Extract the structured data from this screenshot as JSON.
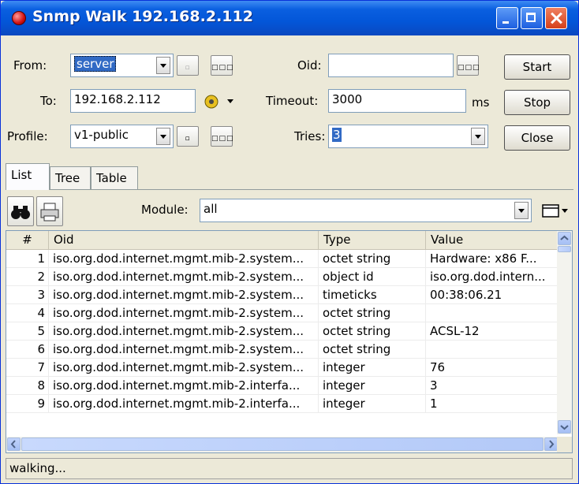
{
  "window": {
    "title": "Snmp Walk 192.168.2.112"
  },
  "form": {
    "from_label": "From:",
    "from_value": "server",
    "to_label": "To:",
    "to_value": "192.168.2.112",
    "profile_label": "Profile:",
    "profile_value": "v1-public",
    "oid_label": "Oid:",
    "oid_value": "",
    "timeout_label": "Timeout:",
    "timeout_value": "3000",
    "timeout_unit": "ms",
    "tries_label": "Tries:",
    "tries_value": "3",
    "small_btn_glyph": "▫",
    "dots_glyph": "□□□"
  },
  "buttons": {
    "start": "Start",
    "stop": "Stop",
    "close": "Close"
  },
  "tabs": [
    {
      "label": "List",
      "active": true
    },
    {
      "label": "Tree",
      "active": false
    },
    {
      "label": "Table",
      "active": false
    }
  ],
  "toolbar": {
    "module_label": "Module:",
    "module_value": "all",
    "icons": [
      "binoculars-icon",
      "printer-icon",
      "columns-icon"
    ]
  },
  "table": {
    "columns": [
      "#",
      "Oid",
      "Type",
      "Value"
    ],
    "rows": [
      {
        "n": "1",
        "oid": "iso.org.dod.internet.mgmt.mib-2.system...",
        "type": "octet string",
        "value": "Hardware: x86 F..."
      },
      {
        "n": "2",
        "oid": "iso.org.dod.internet.mgmt.mib-2.system...",
        "type": "object id",
        "value": "iso.org.dod.intern..."
      },
      {
        "n": "3",
        "oid": "iso.org.dod.internet.mgmt.mib-2.system...",
        "type": "timeticks",
        "value": "00:38:06.21"
      },
      {
        "n": "4",
        "oid": "iso.org.dod.internet.mgmt.mib-2.system...",
        "type": "octet string",
        "value": ""
      },
      {
        "n": "5",
        "oid": "iso.org.dod.internet.mgmt.mib-2.system...",
        "type": "octet string",
        "value": "ACSL-12"
      },
      {
        "n": "6",
        "oid": "iso.org.dod.internet.mgmt.mib-2.system...",
        "type": "octet string",
        "value": ""
      },
      {
        "n": "7",
        "oid": "iso.org.dod.internet.mgmt.mib-2.system...",
        "type": "integer",
        "value": "76"
      },
      {
        "n": "8",
        "oid": "iso.org.dod.internet.mgmt.mib-2.interfa...",
        "type": "integer",
        "value": "3"
      },
      {
        "n": "9",
        "oid": "iso.org.dod.internet.mgmt.mib-2.interfa...",
        "type": "integer",
        "value": "1"
      }
    ]
  },
  "status": {
    "text": "walking..."
  },
  "colors": {
    "title_bar": "#0356d8",
    "window_bg": "#ece9d8",
    "selection": "#316ac5"
  }
}
